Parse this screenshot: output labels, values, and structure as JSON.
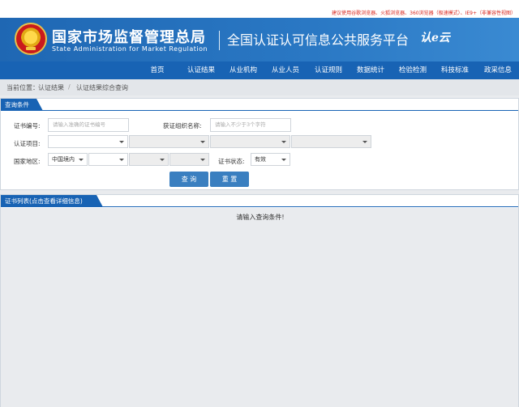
{
  "topbar": {
    "notice": "建议使用谷歌浏览器、火狐浏览器、360浏览器（极速模式）、IE9+（非兼容性视图）"
  },
  "header": {
    "org_cn": "国家市场监督管理总局",
    "org_en": "State Administration  for  Market Regulation",
    "platform": "全国认证认可信息公共服务平台",
    "logo_mark": "认e云"
  },
  "nav": {
    "items": [
      {
        "label": "首页"
      },
      {
        "label": "认证结果"
      },
      {
        "label": "从业机构"
      },
      {
        "label": "从业人员"
      },
      {
        "label": "认证规则"
      },
      {
        "label": "数据统计"
      },
      {
        "label": "检验检测"
      },
      {
        "label": "科技标准"
      },
      {
        "label": "政采信息"
      }
    ]
  },
  "breadcrumb": {
    "prefix": "当前位置：",
    "level1": "认证结果",
    "separator": "/",
    "level2": "认证结果综合查询"
  },
  "query": {
    "title": "查询条件",
    "cert_no_label": "证书编号:",
    "cert_no_placeholder": "请输入准确的证书编号",
    "org_label": "获证组织名称:",
    "org_placeholder": "请输入不少于3个字符",
    "project_label": "认证项目:",
    "region_label": "国家地区:",
    "region_value": "中国境内",
    "status_label": "证书状态:",
    "status_value": "有效",
    "search_button": "查 询",
    "reset_button": "重 置"
  },
  "list": {
    "title": "证书列表(点击查看详细信息)",
    "empty_message": "请输入查询条件!"
  }
}
